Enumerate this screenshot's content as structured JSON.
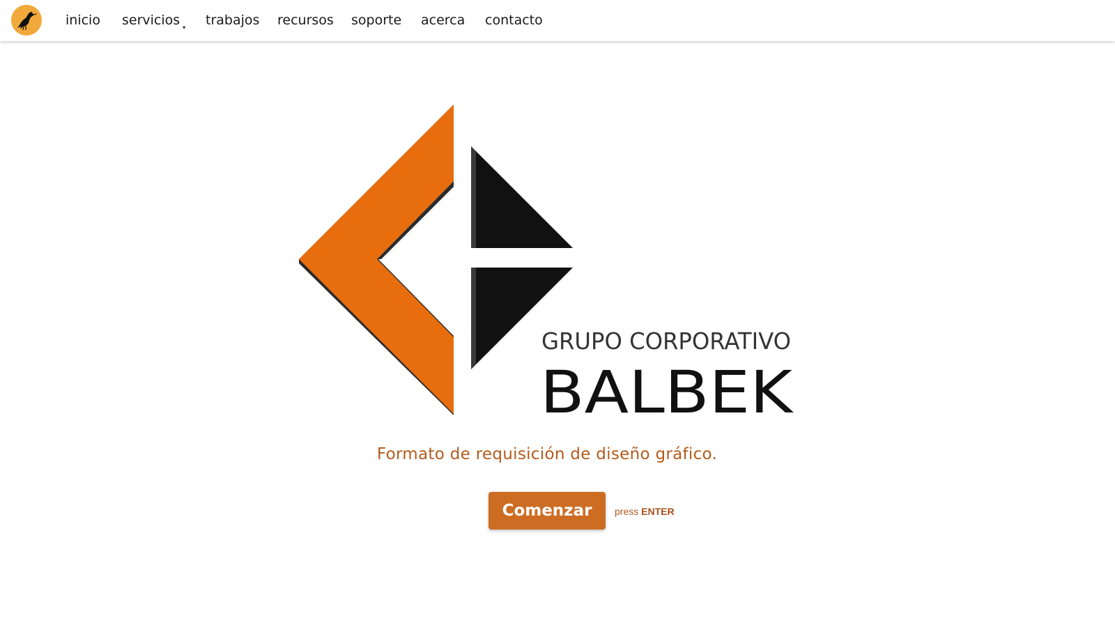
{
  "nav": {
    "logo_icon": "crow-icon",
    "items": [
      {
        "label": "inicio"
      },
      {
        "label": "servicios",
        "has_dropdown": true,
        "caret": "▾"
      },
      {
        "label": "trabajos"
      },
      {
        "label": "recursos"
      },
      {
        "label": "soporte"
      },
      {
        "label": "acerca"
      },
      {
        "label": "contacto"
      }
    ]
  },
  "brand": {
    "line1": "GRUPO CORPORATIVO",
    "line2": "BALBEK",
    "logo_colors": {
      "orange": "#e86d0d",
      "dark": "#111111",
      "shadow": "#2b2b2b"
    }
  },
  "form": {
    "tagline": "Formato de requisición de diseño gráfico.",
    "start_label": "Comenzar",
    "hint_prefix": "press",
    "hint_key": "ENTER",
    "accent_color": "#cd6d24",
    "text_color": "#b35b1d"
  }
}
